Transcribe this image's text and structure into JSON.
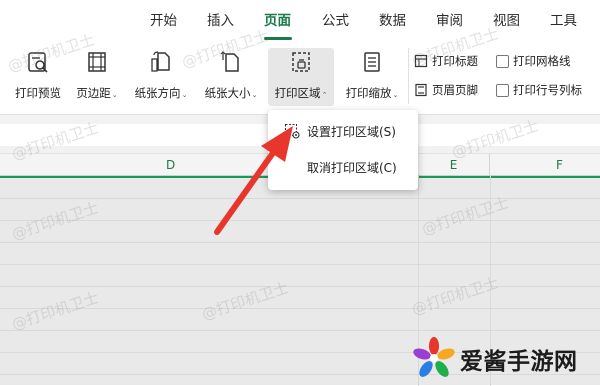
{
  "tabs": [
    {
      "label": "开始"
    },
    {
      "label": "插入"
    },
    {
      "label": "页面"
    },
    {
      "label": "公式"
    },
    {
      "label": "数据"
    },
    {
      "label": "审阅"
    },
    {
      "label": "视图"
    },
    {
      "label": "工具"
    }
  ],
  "toolbar": {
    "print_preview": "打印预览",
    "margins": "页边距",
    "orientation": "纸张方向",
    "paper_size": "纸张大小",
    "print_area": "打印区域",
    "print_scale": "打印缩放",
    "print_titles": "打印标题",
    "header_footer": "页眉页脚",
    "print_gridlines": "打印网格线",
    "print_row_col_headers": "打印行号列标",
    "caret": "⌄",
    "caret_up": "⌃"
  },
  "columns": [
    "D",
    "E",
    "F"
  ],
  "dropdown": {
    "set_print_area": "设置打印区域(S)",
    "cancel_print_area": "取消打印区域(C)"
  },
  "watermark": "@打印机卫士",
  "logo": {
    "text": "爱酱手游网",
    "colors": [
      "#e8362d",
      "#f7a823",
      "#1fae4b",
      "#2a7de1",
      "#9b3fd1"
    ]
  },
  "colors": {
    "accent": "#1a7a4a",
    "arrow": "#e8362d"
  }
}
